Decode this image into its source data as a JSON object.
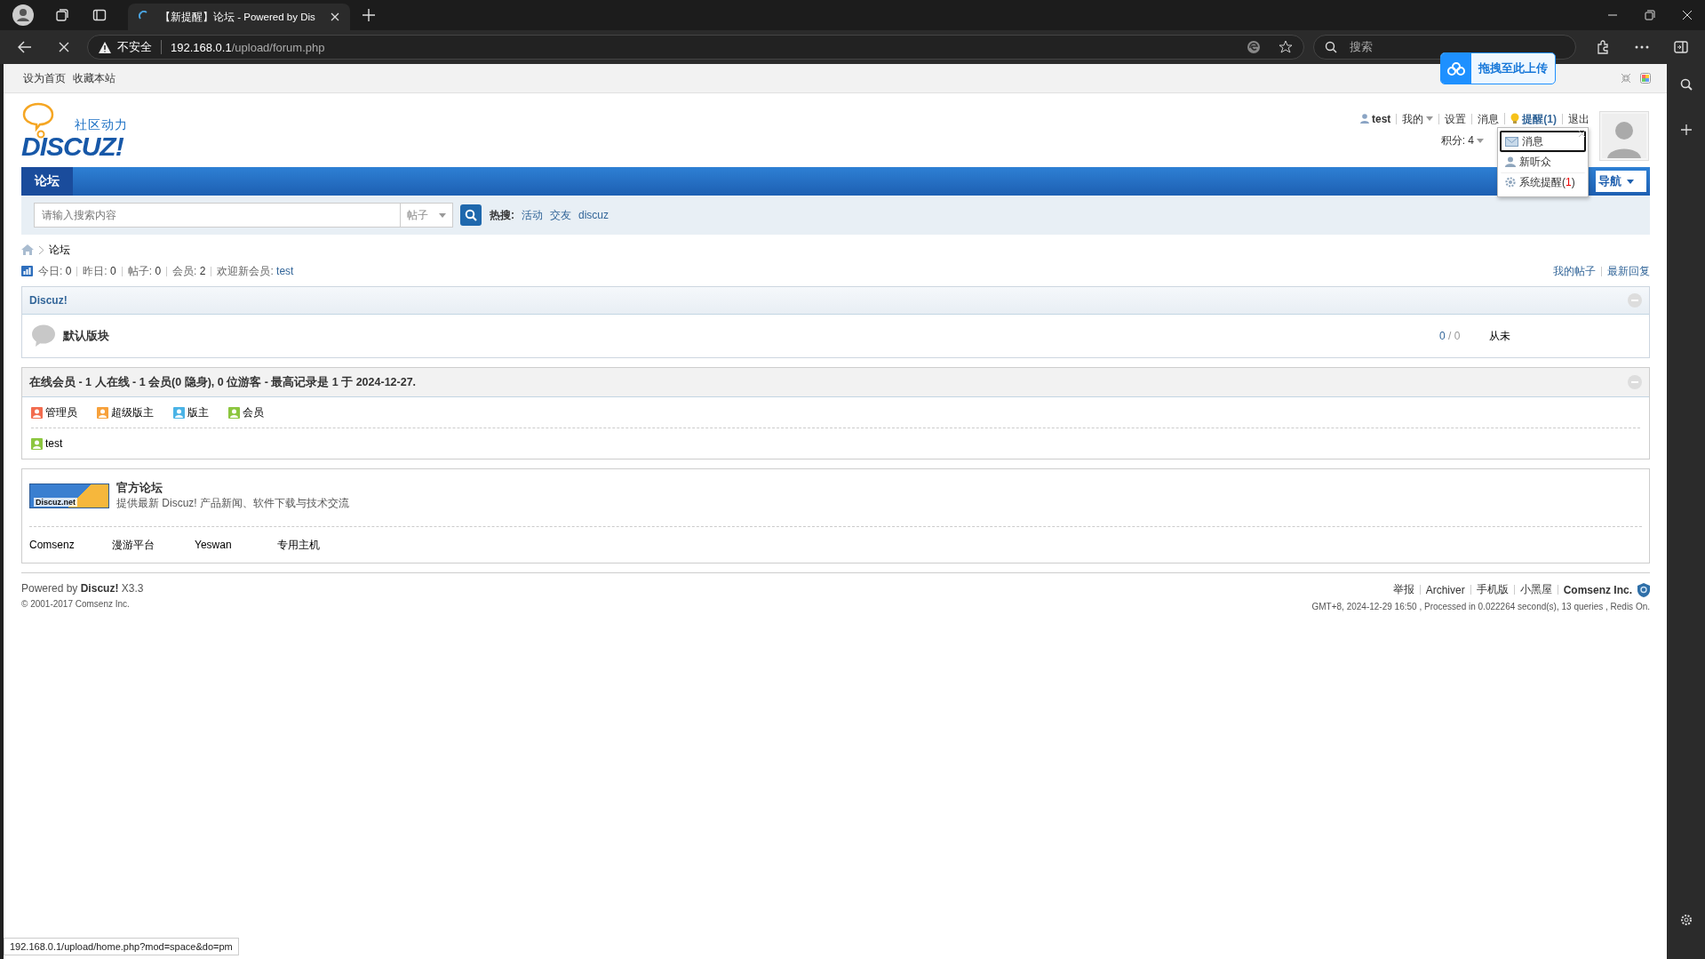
{
  "browser": {
    "tab_title": "【新提醒】论坛 - Powered by Dis",
    "security": "不安全",
    "url_host": "192.168.0.1",
    "url_path": "/upload/forum.php",
    "search_placeholder": "搜索"
  },
  "upload_widget": {
    "label": "拖拽至此上传"
  },
  "topbar": {
    "links": [
      "设为首页",
      "收藏本站"
    ]
  },
  "header": {
    "logo_tagline": "社区动力",
    "logo_wordmark": "DISCUZ!",
    "user_menu": [
      {
        "label": "test",
        "kind": "user"
      },
      {
        "label": "我的",
        "kind": "dropdown"
      },
      {
        "label": "设置",
        "kind": "link"
      },
      {
        "label": "消息",
        "kind": "link"
      },
      {
        "label": "提醒(1)",
        "kind": "notice"
      },
      {
        "label": "退出",
        "kind": "link"
      }
    ],
    "credits": "积分: 4"
  },
  "notice_menu": [
    {
      "label": "消息",
      "kind": "mail",
      "selected": true
    },
    {
      "label": "新听众",
      "kind": "person",
      "selected": false
    },
    {
      "label": "系统提醒(**1**)",
      "kind": "gear",
      "selected": false
    }
  ],
  "nav": {
    "tabs": [
      {
        "label": "论坛",
        "selected": true
      }
    ],
    "quick_nav": "导航"
  },
  "search": {
    "placeholder": "请输入搜索内容",
    "type": "帖子",
    "hot_label": "热搜:",
    "hot_terms": [
      "活动",
      "交友",
      "discuz"
    ]
  },
  "breadcrumb": [
    "论坛"
  ],
  "stats": [
    {
      "label": "今日:",
      "value": "0"
    },
    {
      "label": "昨日:",
      "value": "0"
    },
    {
      "label": "帖子:",
      "value": "0"
    },
    {
      "label": "会员:",
      "value": "2"
    },
    {
      "label": "欢迎新会员:",
      "value": "test"
    }
  ],
  "quick_links": [
    "我的帖子",
    "最新回复"
  ],
  "category": {
    "title": "Discuz!",
    "forums": [
      {
        "name": "默认版块",
        "counts": "**0** / 0",
        "last_post": "从未"
      }
    ]
  },
  "online": {
    "title": "在线会员 - 1 人在线 - 1 会员(0 隐身), 0 位游客 - 最高记录是 1 于 2024-12-27.",
    "legend": [
      {
        "label": "管理员",
        "color": "#f26c4f"
      },
      {
        "label": "超级版主",
        "color": "#f7a13b"
      },
      {
        "label": "版主",
        "color": "#4ab3e6"
      },
      {
        "label": "会员",
        "color": "#8cc63f"
      }
    ],
    "users": [
      {
        "name": "test",
        "color": "#8cc63f"
      }
    ]
  },
  "friend_links": {
    "featured": {
      "name": "官方论坛",
      "description": "提供最新 Discuz! 产品新闻、软件下载与技术交流",
      "banner_text": "Discuz.net"
    },
    "links": [
      "Comsenz",
      "漫游平台",
      "Yeswan",
      "专用主机"
    ]
  },
  "footer": {
    "powered": "Powered by **Discuz!** X3.3",
    "copyright": "© 2001-2017 Comsenz Inc.",
    "links": [
      "举报",
      "Archiver",
      "手机版",
      "小黑屋"
    ],
    "company": "Comsenz Inc.",
    "debug": "GMT+8, 2024-12-29 16:50 , Processed in 0.022264 second(s), 13 queries , Redis On."
  },
  "status_url": "192.168.0.1/upload/home.php?mod=space&do=pm"
}
